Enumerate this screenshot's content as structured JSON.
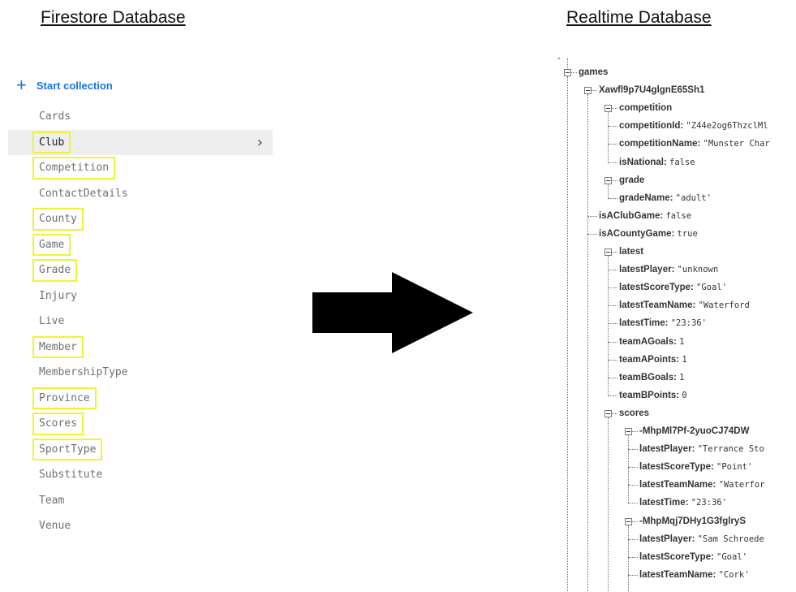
{
  "headings": {
    "firestore": "Firestore Database",
    "realtime": "Realtime Database"
  },
  "firestore": {
    "start_collection": "Start collection",
    "collections": [
      {
        "name": "Cards",
        "highlighted": false,
        "selected": false
      },
      {
        "name": "Club",
        "highlighted": true,
        "selected": true
      },
      {
        "name": "Competition",
        "highlighted": true,
        "selected": false
      },
      {
        "name": "ContactDetails",
        "highlighted": false,
        "selected": false
      },
      {
        "name": "County",
        "highlighted": true,
        "selected": false
      },
      {
        "name": "Game",
        "highlighted": true,
        "selected": false
      },
      {
        "name": "Grade",
        "highlighted": true,
        "selected": false
      },
      {
        "name": "Injury",
        "highlighted": false,
        "selected": false
      },
      {
        "name": "Live",
        "highlighted": false,
        "selected": false
      },
      {
        "name": "Member",
        "highlighted": true,
        "selected": false
      },
      {
        "name": "MembershipType",
        "highlighted": false,
        "selected": false
      },
      {
        "name": "Province",
        "highlighted": true,
        "selected": false
      },
      {
        "name": "Scores",
        "highlighted": true,
        "selected": false
      },
      {
        "name": "SportType",
        "highlighted": true,
        "selected": false
      },
      {
        "name": "Substitute",
        "highlighted": false,
        "selected": false
      },
      {
        "name": "Team",
        "highlighted": false,
        "selected": false
      },
      {
        "name": "Venue",
        "highlighted": false,
        "selected": false
      }
    ],
    "highlight_color": "#f2f230",
    "accent_color": "#1a73e8"
  },
  "realtime": {
    "root_marker": "-",
    "tree": [
      {
        "depth": 0,
        "key": "games",
        "value": null,
        "expandable": true
      },
      {
        "depth": 1,
        "key": "Xawfl9p7U4glgnE65Sh1",
        "value": null,
        "expandable": true
      },
      {
        "depth": 2,
        "key": "competition",
        "value": null,
        "expandable": true
      },
      {
        "depth": 3,
        "key": "competitionId:",
        "value": "\"Z44e2og6ThzclMl",
        "expandable": false
      },
      {
        "depth": 3,
        "key": "competitionName:",
        "value": "\"Munster Char",
        "expandable": false
      },
      {
        "depth": 3,
        "key": "isNational:",
        "value": "false",
        "expandable": false
      },
      {
        "depth": 2,
        "key": "grade",
        "value": null,
        "expandable": true
      },
      {
        "depth": 3,
        "key": "gradeName:",
        "value": "\"adult'",
        "expandable": false
      },
      {
        "depth": 2,
        "key": "isAClubGame:",
        "value": "false",
        "expandable": false
      },
      {
        "depth": 2,
        "key": "isACountyGame:",
        "value": "true",
        "expandable": false
      },
      {
        "depth": 2,
        "key": "latest",
        "value": null,
        "expandable": true
      },
      {
        "depth": 3,
        "key": "latestPlayer:",
        "value": "\"unknown",
        "expandable": false
      },
      {
        "depth": 3,
        "key": "latestScoreType:",
        "value": "\"Goal'",
        "expandable": false
      },
      {
        "depth": 3,
        "key": "latestTeamName:",
        "value": "\"Waterford",
        "expandable": false
      },
      {
        "depth": 3,
        "key": "latestTime:",
        "value": "\"23:36'",
        "expandable": false
      },
      {
        "depth": 3,
        "key": "teamAGoals:",
        "value": "1",
        "expandable": false
      },
      {
        "depth": 3,
        "key": "teamAPoints:",
        "value": "1",
        "expandable": false
      },
      {
        "depth": 3,
        "key": "teamBGoals:",
        "value": "1",
        "expandable": false
      },
      {
        "depth": 3,
        "key": "teamBPoints:",
        "value": "0",
        "expandable": false
      },
      {
        "depth": 2,
        "key": "scores",
        "value": null,
        "expandable": true
      },
      {
        "depth": 3,
        "key": "-MhpMl7Pf-2yuoCJ74DW",
        "value": null,
        "expandable": true
      },
      {
        "depth": 4,
        "key": "latestPlayer:",
        "value": "\"Terrance Sto",
        "expandable": false
      },
      {
        "depth": 4,
        "key": "latestScoreType:",
        "value": "\"Point'",
        "expandable": false
      },
      {
        "depth": 4,
        "key": "latestTeamName:",
        "value": "\"Waterfor",
        "expandable": false
      },
      {
        "depth": 4,
        "key": "latestTime:",
        "value": "\"23:36'",
        "expandable": false
      },
      {
        "depth": 3,
        "key": "-MhpMqj7DHy1G3fglryS",
        "value": null,
        "expandable": true
      },
      {
        "depth": 4,
        "key": "latestPlayer:",
        "value": "\"Sam Schroede",
        "expandable": false
      },
      {
        "depth": 4,
        "key": "latestScoreType:",
        "value": "\"Goal'",
        "expandable": false
      },
      {
        "depth": 4,
        "key": "latestTeamName:",
        "value": "\"Cork'",
        "expandable": false
      }
    ]
  }
}
